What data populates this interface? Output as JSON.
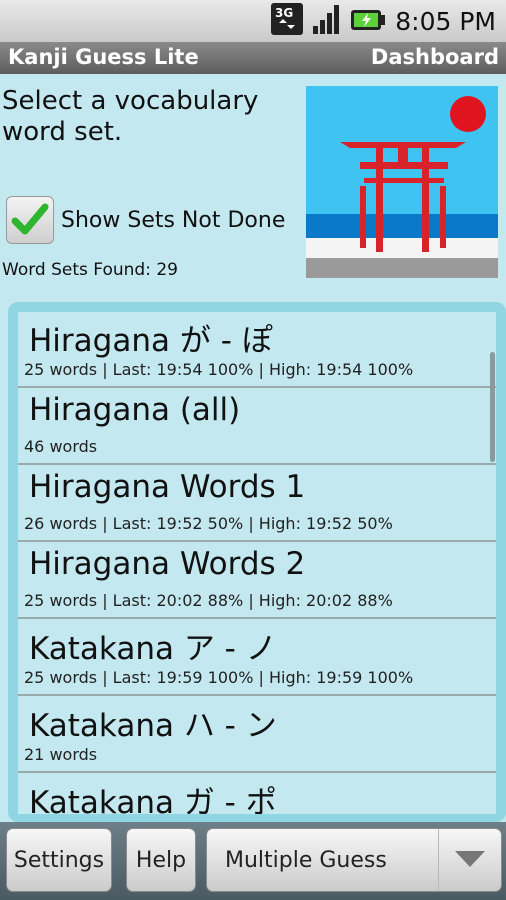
{
  "status": {
    "network": "3G",
    "time": "8:05 PM"
  },
  "title": {
    "app": "Kanji Guess Lite",
    "dashboard": "Dashboard"
  },
  "prompt": "Select a vocabulary word set.",
  "filter": {
    "label": "Show Sets Not Done",
    "checked": true
  },
  "found": "Word Sets Found: 29",
  "word_sets": [
    {
      "name": "Hiragana が - ぽ",
      "meta": "25 words | Last: 19:54 100% | High: 19:54 100%"
    },
    {
      "name": "Hiragana (all)",
      "meta": "46 words"
    },
    {
      "name": "Hiragana Words 1",
      "meta": "26 words | Last: 19:52 50% | High: 19:52 50%"
    },
    {
      "name": "Hiragana Words 2",
      "meta": "25 words | Last: 20:02 88% | High: 20:02 88%"
    },
    {
      "name": "Katakana ア - ノ",
      "meta": "25 words | Last: 19:59 100% | High: 19:59 100%"
    },
    {
      "name": "Katakana ハ - ン",
      "meta": "21 words"
    },
    {
      "name": "Katakana ガ - ポ",
      "meta": ""
    }
  ],
  "buttons": {
    "settings": "Settings",
    "help": "Help",
    "mode": "Multiple Guess"
  },
  "colors": {
    "background": "#c4e8ef",
    "list_frame": "#8fd5e2",
    "title_bar": "#6e6e6e",
    "torii_red": "#d8232a",
    "sun_red": "#e0141e",
    "check_green": "#2db52d"
  }
}
